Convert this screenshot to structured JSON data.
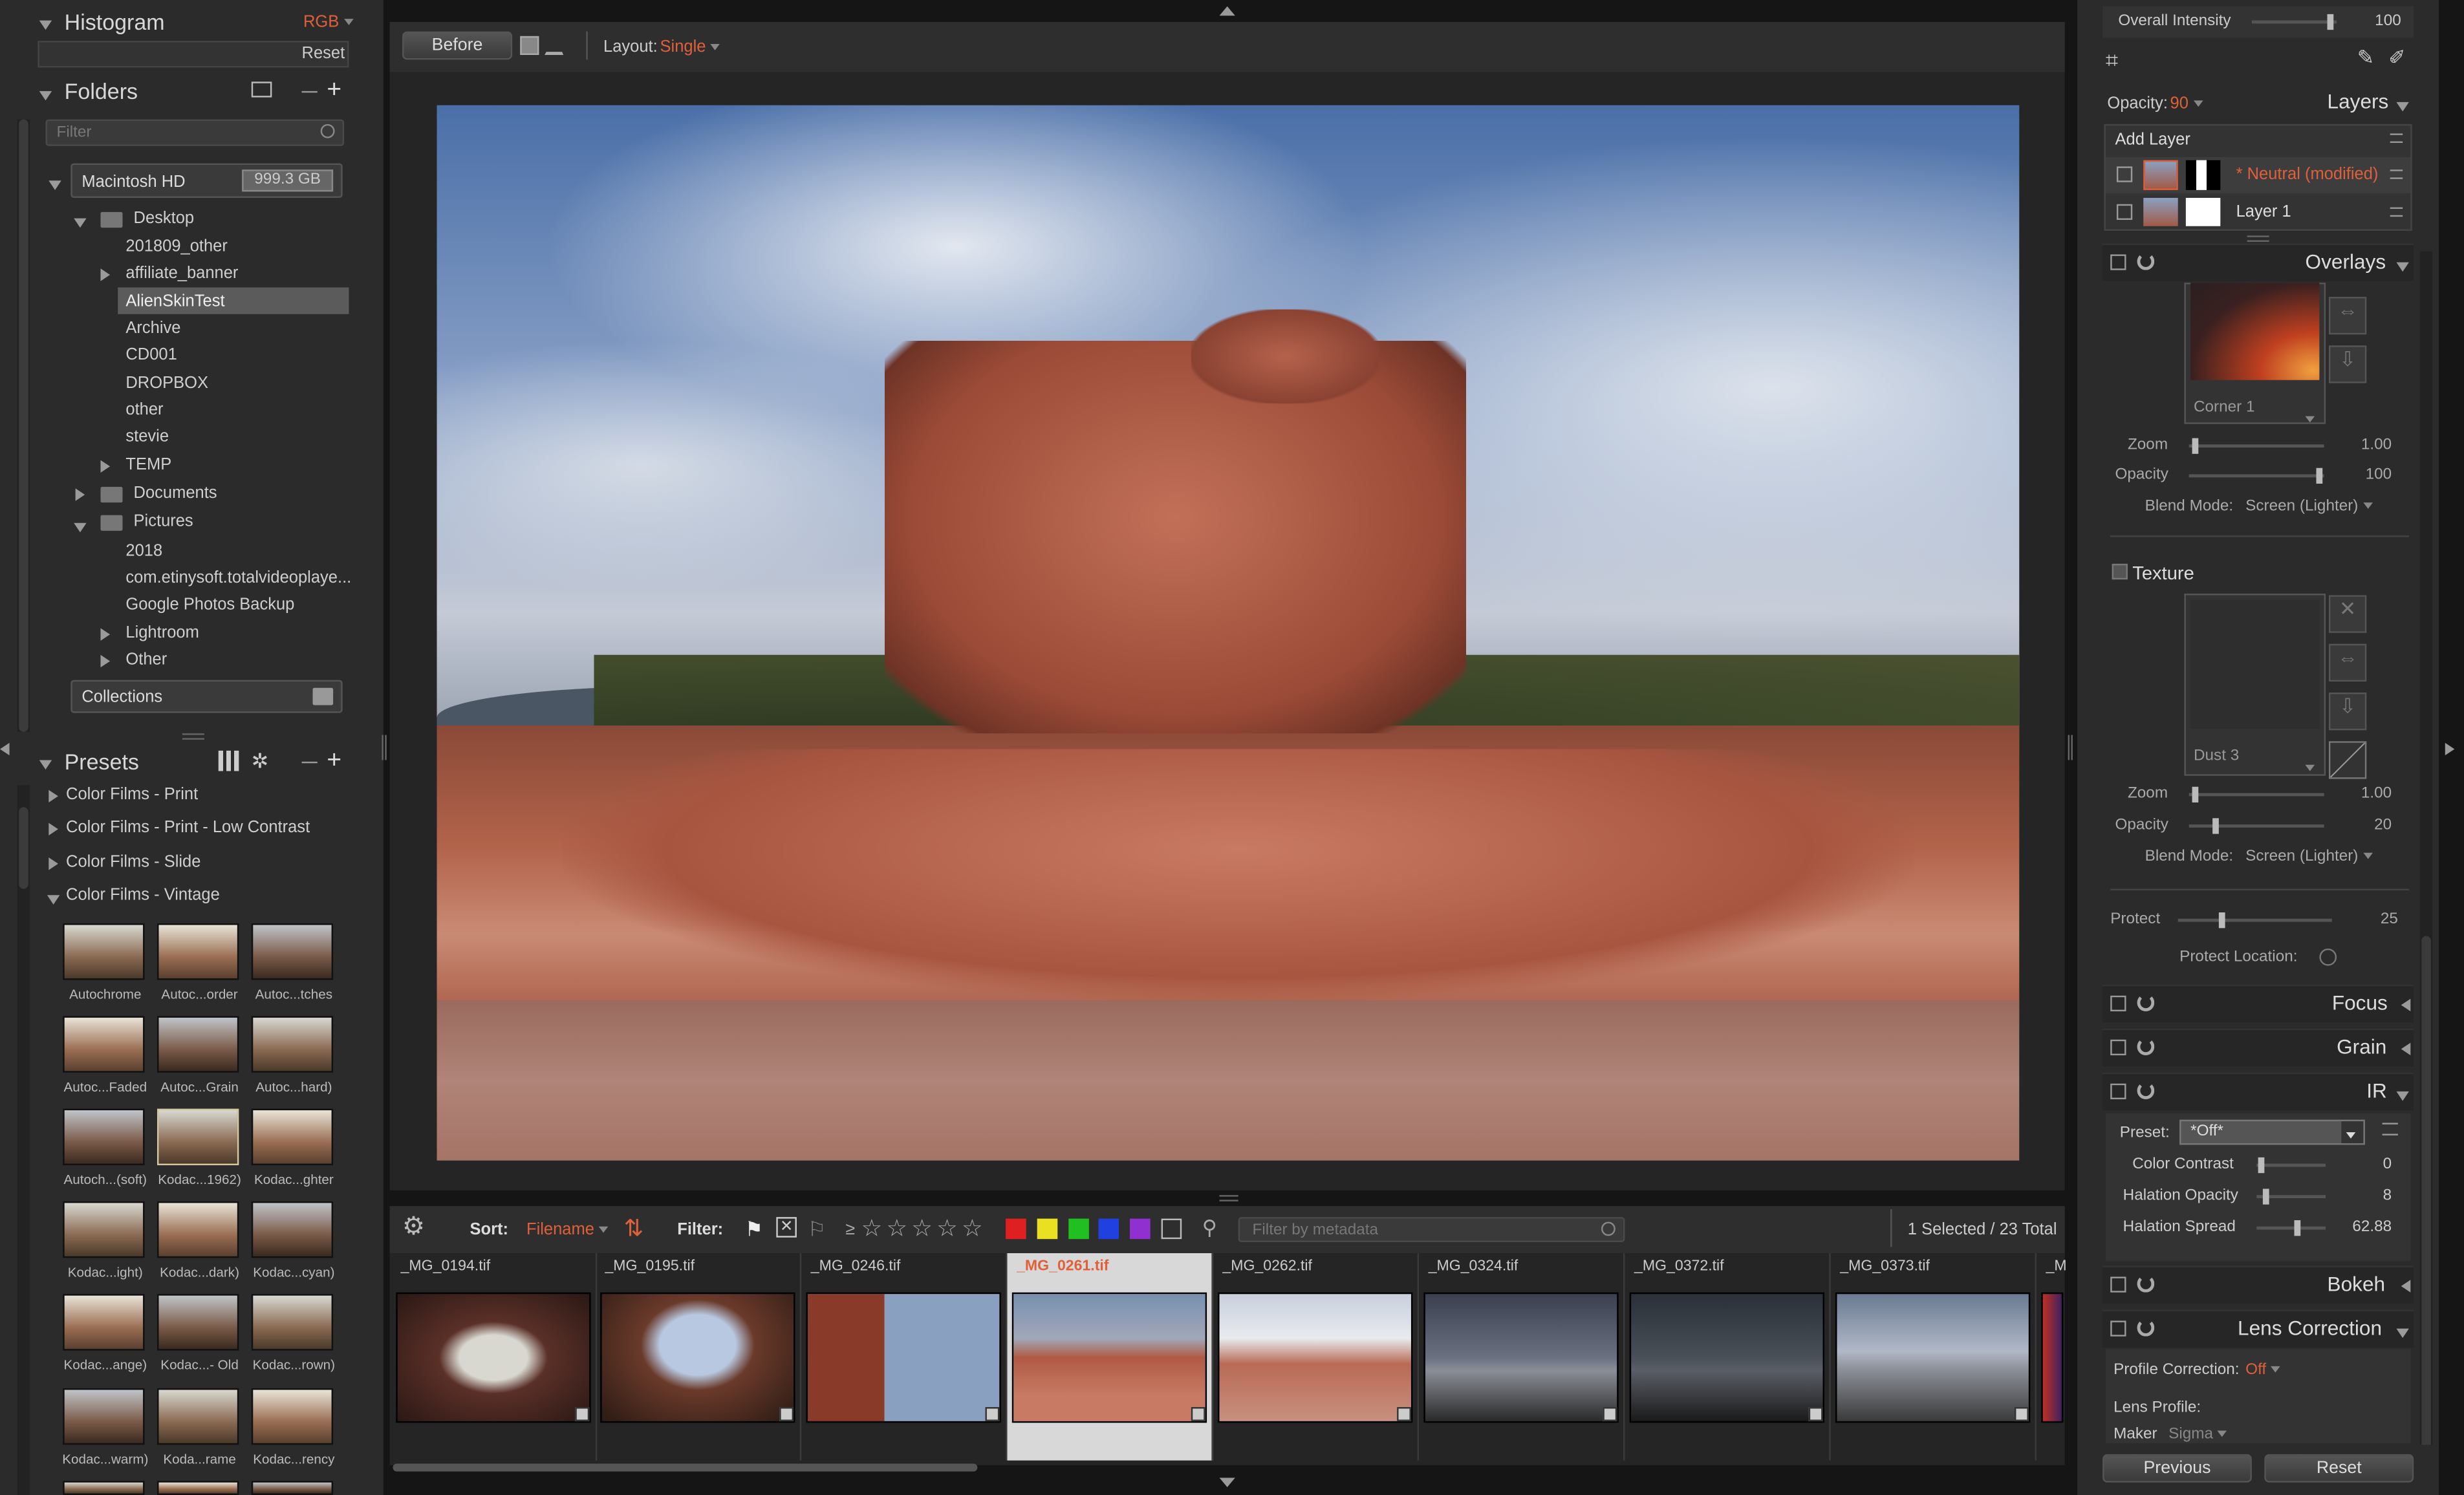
{
  "histogram": {
    "title": "Histogram",
    "channel": "RGB",
    "reset": "Reset"
  },
  "folders": {
    "title": "Folders",
    "filter_placeholder": "Filter",
    "drive": "Macintosh HD",
    "drive_size": "999.3 GB",
    "items": [
      "Desktop",
      "201809_other",
      "affiliate_banner",
      "AlienSkinTest",
      "Archive",
      "CD001",
      "DROPBOX",
      "other",
      "stevie",
      "TEMP",
      "Documents",
      "Pictures",
      "2018",
      "com.etinysoft.totalvideoplaye...",
      "Google Photos Backup",
      "Lightroom",
      "Other"
    ],
    "collections": "Collections"
  },
  "presets": {
    "title": "Presets",
    "groups": [
      "Color Films - Print",
      "Color Films - Print - Low Contrast",
      "Color Films - Slide",
      "Color Films - Vintage"
    ],
    "items": [
      "Autochrome",
      "Autoc...order",
      "Autoc...tches",
      "Autoc...Faded",
      "Autoc...Grain",
      "Autoc...hard)",
      "Autoch...(soft)",
      "Kodac...1962)",
      "Kodac...ghter",
      "Kodac...ight)",
      "Kodac...dark)",
      "Kodac...cyan)",
      "Kodac...ange)",
      "Kodac...- Old",
      "Kodac...rown)",
      "Kodac...warm)",
      "Koda...rame",
      "Kodac...rency"
    ]
  },
  "toolbar": {
    "before": "Before",
    "layout_label": "Layout:",
    "layout_value": "Single"
  },
  "filmstrip": {
    "sort_label": "Sort:",
    "sort_value": "Filename",
    "filter_label": "Filter:",
    "stars_prefix": "≥",
    "metadata_placeholder": "Filter by metadata",
    "count": "1 Selected / 23 Total",
    "files": [
      "_MG_0194.tif",
      "_MG_0195.tif",
      "_MG_0246.tif",
      "_MG_0261.tif",
      "_MG_0262.tif",
      "_MG_0324.tif",
      "_MG_0372.tif",
      "_MG_0373.tif",
      "_M"
    ],
    "colors": [
      "#e02020",
      "#e8e020",
      "#20c020",
      "#2040e0",
      "#9030d0"
    ]
  },
  "right": {
    "overall_intensity": "Overall Intensity",
    "overall_value": "100",
    "opacity_label": "Opacity:",
    "opacity_value": "90",
    "layers": "Layers",
    "add_layer": "Add Layer",
    "layer_neutral": "* Neutral (modified)",
    "layer1": "Layer 1",
    "overlays": "Overlays",
    "corner": "Corner 1",
    "zoom": "Zoom",
    "zoom1": "1.00",
    "opacity": "Opacity",
    "opacity1": "100",
    "blend": "Blend Mode:",
    "blend_value": "Screen (Lighter)",
    "texture": "Texture",
    "dust": "Dust 3",
    "zoom2": "1.00",
    "opacity2": "20",
    "protect": "Protect",
    "protect_value": "25",
    "protect_location": "Protect Location:",
    "focus": "Focus",
    "grain": "Grain",
    "ir": "IR",
    "preset_label": "Preset:",
    "preset_value": "*Off*",
    "color_contrast": "Color Contrast",
    "cc_value": "0",
    "halation_opacity": "Halation Opacity",
    "ho_value": "8",
    "halation_spread": "Halation Spread",
    "hs_value": "62.88",
    "bokeh": "Bokeh",
    "lens": "Lens Correction",
    "profile_label": "Profile Correction:",
    "profile_value": "Off",
    "lens_profile": "Lens Profile:",
    "maker_label": "Maker",
    "maker_value": "Sigma",
    "previous": "Previous",
    "reset": "Reset"
  }
}
